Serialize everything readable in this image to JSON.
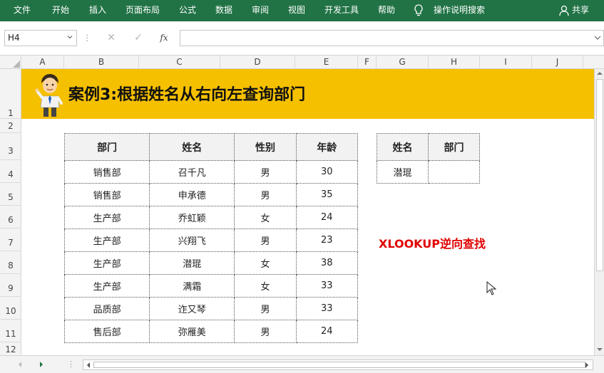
{
  "ribbon": {
    "tabs": [
      "文件",
      "开始",
      "插入",
      "页面布局",
      "公式",
      "数据",
      "审阅",
      "视图",
      "开发工具",
      "帮助"
    ],
    "tell_me": "操作说明搜索",
    "share": "共享"
  },
  "formula_bar": {
    "name_box": "H4",
    "fx_label": "fx",
    "formula": ""
  },
  "columns": [
    "A",
    "B",
    "C",
    "D",
    "E",
    "F",
    "G",
    "H",
    "I",
    "J"
  ],
  "rows": [
    "1",
    "2",
    "3",
    "4",
    "5",
    "6",
    "7",
    "8",
    "9",
    "10",
    "11",
    "12"
  ],
  "banner": {
    "title": "案例3:根据姓名从右向左查询部门"
  },
  "main_table": {
    "headers": [
      "部门",
      "姓名",
      "性别",
      "年龄"
    ],
    "rows": [
      [
        "销售部",
        "召千凡",
        "男",
        "30"
      ],
      [
        "销售部",
        "申承德",
        "男",
        "35"
      ],
      [
        "生产部",
        "乔虹颖",
        "女",
        "24"
      ],
      [
        "生产部",
        "兴翔飞",
        "男",
        "23"
      ],
      [
        "生产部",
        "潜琨",
        "女",
        "38"
      ],
      [
        "生产部",
        "满霜",
        "女",
        "33"
      ],
      [
        "品质部",
        "迮又琴",
        "男",
        "33"
      ],
      [
        "售后部",
        "弥雁美",
        "男",
        "24"
      ]
    ]
  },
  "lookup_table": {
    "headers": [
      "姓名",
      "部门"
    ],
    "row": [
      "潜琨",
      ""
    ]
  },
  "note": "XLOOKUP逆向查找",
  "colors": {
    "ribbon": "#217346",
    "banner": "#f5c000",
    "note": "#e00000"
  }
}
